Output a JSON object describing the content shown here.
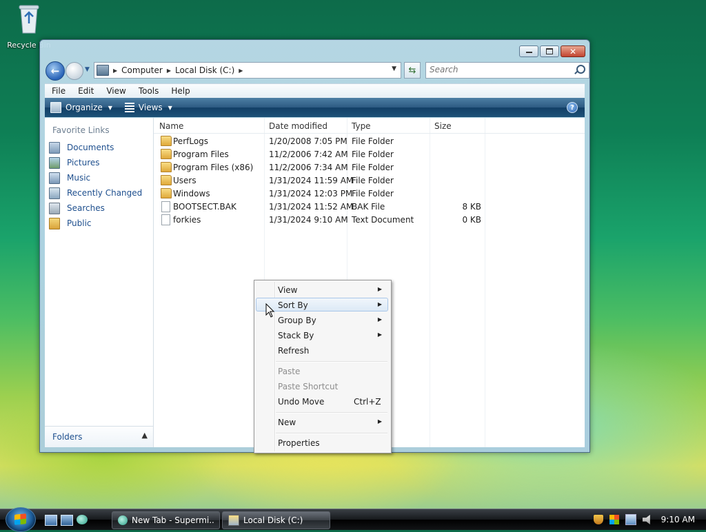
{
  "desktop": {
    "recycle_bin_label": "Recycle Bin"
  },
  "window": {
    "controls": {
      "minimize": "minimize",
      "maximize": "maximize",
      "close": "close"
    },
    "address": {
      "crumbs": [
        "Computer",
        "Local Disk (C:)"
      ]
    },
    "search": {
      "placeholder": "Search"
    },
    "menu": [
      "File",
      "Edit",
      "View",
      "Tools",
      "Help"
    ],
    "toolbar": {
      "organize": "Organize",
      "views": "Views",
      "help": "?"
    },
    "favorite_links": {
      "title": "Favorite Links",
      "items": [
        {
          "label": "Documents",
          "icon": "documents-icon"
        },
        {
          "label": "Pictures",
          "icon": "pictures-icon"
        },
        {
          "label": "Music",
          "icon": "music-icon"
        },
        {
          "label": "Recently Changed",
          "icon": "recently-changed-icon"
        },
        {
          "label": "Searches",
          "icon": "searches-icon"
        },
        {
          "label": "Public",
          "icon": "public-folder-icon"
        }
      ]
    },
    "folders_label": "Folders",
    "columns": {
      "name": "Name",
      "date": "Date modified",
      "type": "Type",
      "size": "Size"
    },
    "files": [
      {
        "name": "PerfLogs",
        "date": "1/20/2008 7:05 PM",
        "type": "File Folder",
        "size": "",
        "kind": "folder"
      },
      {
        "name": "Program Files",
        "date": "11/2/2006 7:42 AM",
        "type": "File Folder",
        "size": "",
        "kind": "folder"
      },
      {
        "name": "Program Files (x86)",
        "date": "11/2/2006 7:34 AM",
        "type": "File Folder",
        "size": "",
        "kind": "folder"
      },
      {
        "name": "Users",
        "date": "1/31/2024 11:59 AM",
        "type": "File Folder",
        "size": "",
        "kind": "folder"
      },
      {
        "name": "Windows",
        "date": "1/31/2024 12:03 PM",
        "type": "File Folder",
        "size": "",
        "kind": "folder"
      },
      {
        "name": "BOOTSECT.BAK",
        "date": "1/31/2024 11:52 AM",
        "type": "BAK File",
        "size": "8 KB",
        "kind": "file"
      },
      {
        "name": "forkies",
        "date": "1/31/2024 9:10 AM",
        "type": "Text Document",
        "size": "0 KB",
        "kind": "file"
      }
    ]
  },
  "context_menu": {
    "view": "View",
    "sort_by": "Sort By",
    "group_by": "Group By",
    "stack_by": "Stack By",
    "refresh": "Refresh",
    "paste": "Paste",
    "paste_shortcut": "Paste Shortcut",
    "undo_move": "Undo Move",
    "undo_shortcut": "Ctrl+Z",
    "new": "New",
    "properties": "Properties"
  },
  "taskbar": {
    "tasks": [
      "New Tab - Supermi...",
      "Local Disk (C:)"
    ],
    "clock": "9:10 AM"
  }
}
